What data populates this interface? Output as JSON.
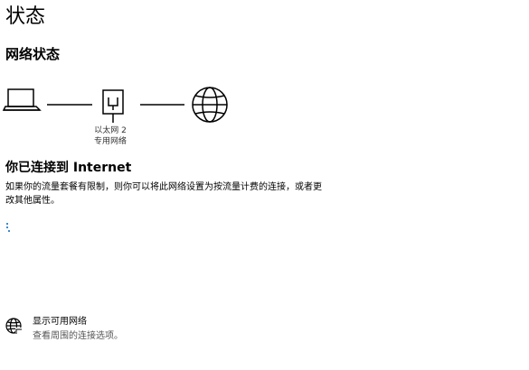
{
  "page": {
    "title": "状态"
  },
  "network_status": {
    "heading": "网络状态",
    "adapter_name": "以太网 2",
    "adapter_type": "专用网络",
    "icons": [
      "laptop-icon",
      "ethernet-icon",
      "globe-icon"
    ]
  },
  "connection": {
    "title": "你已连接到 Internet",
    "description": "如果你的流量套餐有限制，则你可以将此网络设置为按流量计费的连接，或者更改其他属性。"
  },
  "show_networks": {
    "title": "显示可用网络",
    "description": "查看周围的连接选项。",
    "icon": "globe-icon"
  },
  "colors": {
    "text": "#000000",
    "secondary_text": "#555555",
    "spinner": "#0067c0"
  }
}
